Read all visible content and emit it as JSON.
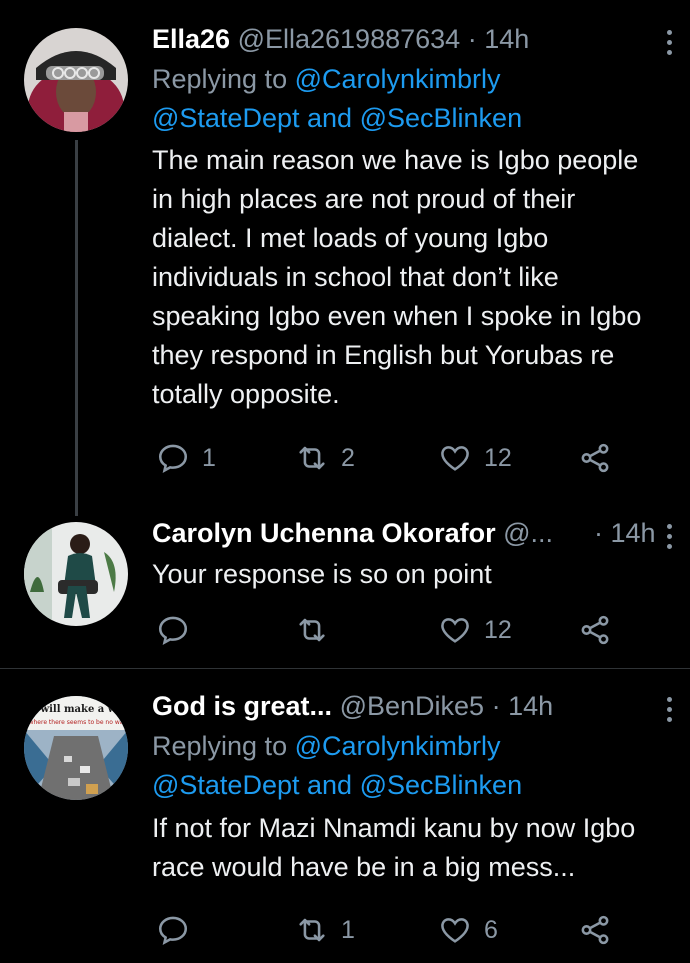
{
  "tweets": [
    {
      "name": "Ella26",
      "handle": "@Ella2619887634",
      "dot": "·",
      "time": "14h",
      "replying_prefix": "Replying to",
      "reply_to_1": "@Carolynkimbrly",
      "reply_to_2": "@StateDept",
      "reply_and": "and",
      "reply_to_3": "@SecBlinken",
      "text": "The main reason we have is Igbo people\nin high places are not proud of their\ndialect. I met loads of young Igbo\nindividuals in school that don’t like\nspeaking Igbo even when I spoke in Igbo\nthey respond in English but Yorubas re\ntotally opposite.",
      "replies": "1",
      "retweets": "2",
      "likes": "12"
    },
    {
      "name": "Carolyn Uchenna Okorafor",
      "handle": "@...",
      "dot": "·",
      "time": "14h",
      "text": "Your response is so on point",
      "replies": "",
      "retweets": "",
      "likes": "12"
    },
    {
      "name": "God is great...",
      "handle": "@BenDike5",
      "dot": "·",
      "time": "14h",
      "replying_prefix": "Replying to",
      "reply_to_1": "@Carolynkimbrly",
      "reply_to_2": "@StateDept",
      "reply_and": "and",
      "reply_to_3": "@SecBlinken",
      "text": "If not for Mazi Nnamdi kanu by now Igbo\nrace would have be in a big mess...",
      "replies": "",
      "retweets": "1",
      "likes": "6",
      "avatar_text_1": "od will make a way",
      "avatar_text_2": "where there seems to be no wa"
    }
  ],
  "colors": {
    "background": "#000000",
    "secondary_text": "#8b98a5",
    "mention": "#1d9bf0",
    "divider": "#2f3336"
  },
  "icons": [
    "reply-icon",
    "retweet-icon",
    "like-icon",
    "share-icon",
    "more-icon"
  ]
}
